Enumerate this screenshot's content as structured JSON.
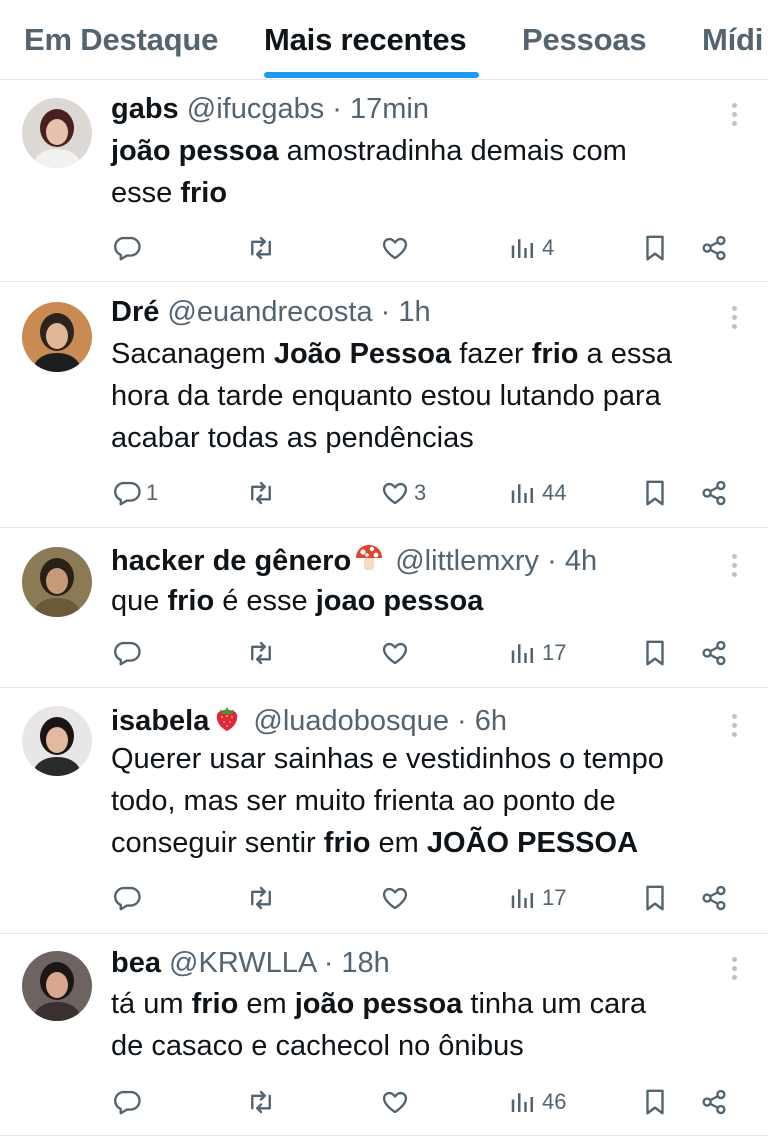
{
  "tabs": [
    {
      "label": "Em Destaque"
    },
    {
      "label": "Mais recentes"
    },
    {
      "label": "Pessoas"
    },
    {
      "label": "Mídi"
    }
  ],
  "accent_color": "#1d9bf0",
  "tweets": [
    {
      "name": "gabs",
      "handle": "@ifucgabs",
      "sep": "·",
      "time": "17min",
      "emoji": "",
      "text": [
        [
          {
            "t": "joão pessoa",
            "b": true
          },
          {
            "t": " amostradinha demais com"
          }
        ],
        [
          {
            "t": "esse "
          },
          {
            "t": "frio",
            "b": true
          }
        ]
      ],
      "replies": "",
      "retweets": "",
      "likes": "",
      "views": "4"
    },
    {
      "name": "Dré",
      "handle": "@euandrecosta",
      "sep": "·",
      "time": "1h",
      "emoji": "",
      "text": [
        [
          {
            "t": "Sacanagem "
          },
          {
            "t": "João Pessoa",
            "b": true
          },
          {
            "t": " fazer "
          },
          {
            "t": "frio",
            "b": true
          },
          {
            "t": " a essa"
          }
        ],
        [
          {
            "t": "hora da tarde enquanto estou lutando para"
          }
        ],
        [
          {
            "t": "acabar todas as pendências"
          }
        ]
      ],
      "replies": "1",
      "retweets": "",
      "likes": "3",
      "views": "44"
    },
    {
      "name": "hacker de gênero",
      "handle": "@littlemxry",
      "sep": "·",
      "time": "4h",
      "emoji": "mushroom-icon",
      "text": [
        [
          {
            "t": "que "
          },
          {
            "t": "frio",
            "b": true
          },
          {
            "t": " é esse "
          },
          {
            "t": "joao pessoa",
            "b": true
          }
        ]
      ],
      "replies": "",
      "retweets": "",
      "likes": "",
      "views": "17"
    },
    {
      "name": "isabela",
      "handle": "@luadobosque",
      "sep": "·",
      "time": "6h",
      "emoji": "strawberry-icon",
      "text": [
        [
          {
            "t": "Querer usar sainhas e vestidinhos o tempo"
          }
        ],
        [
          {
            "t": "todo, mas ser muito frienta ao ponto de"
          }
        ],
        [
          {
            "t": "conseguir sentir "
          },
          {
            "t": "frio",
            "b": true
          },
          {
            "t": " em "
          },
          {
            "t": "JOÃO PESSOA",
            "b": true
          }
        ]
      ],
      "replies": "",
      "retweets": "",
      "likes": "",
      "views": "17"
    },
    {
      "name": "bea",
      "handle": "@KRWLLA",
      "sep": "·",
      "time": "18h",
      "emoji": "",
      "text": [
        [
          {
            "t": "tá um "
          },
          {
            "t": "frio",
            "b": true
          },
          {
            "t": " em "
          },
          {
            "t": "joão pessoa",
            "b": true
          },
          {
            "t": " tinha um cara"
          }
        ],
        [
          {
            "t": "de casaco e cachecol no ônibus"
          }
        ]
      ],
      "replies": "",
      "retweets": "",
      "likes": "",
      "views": "46"
    }
  ]
}
